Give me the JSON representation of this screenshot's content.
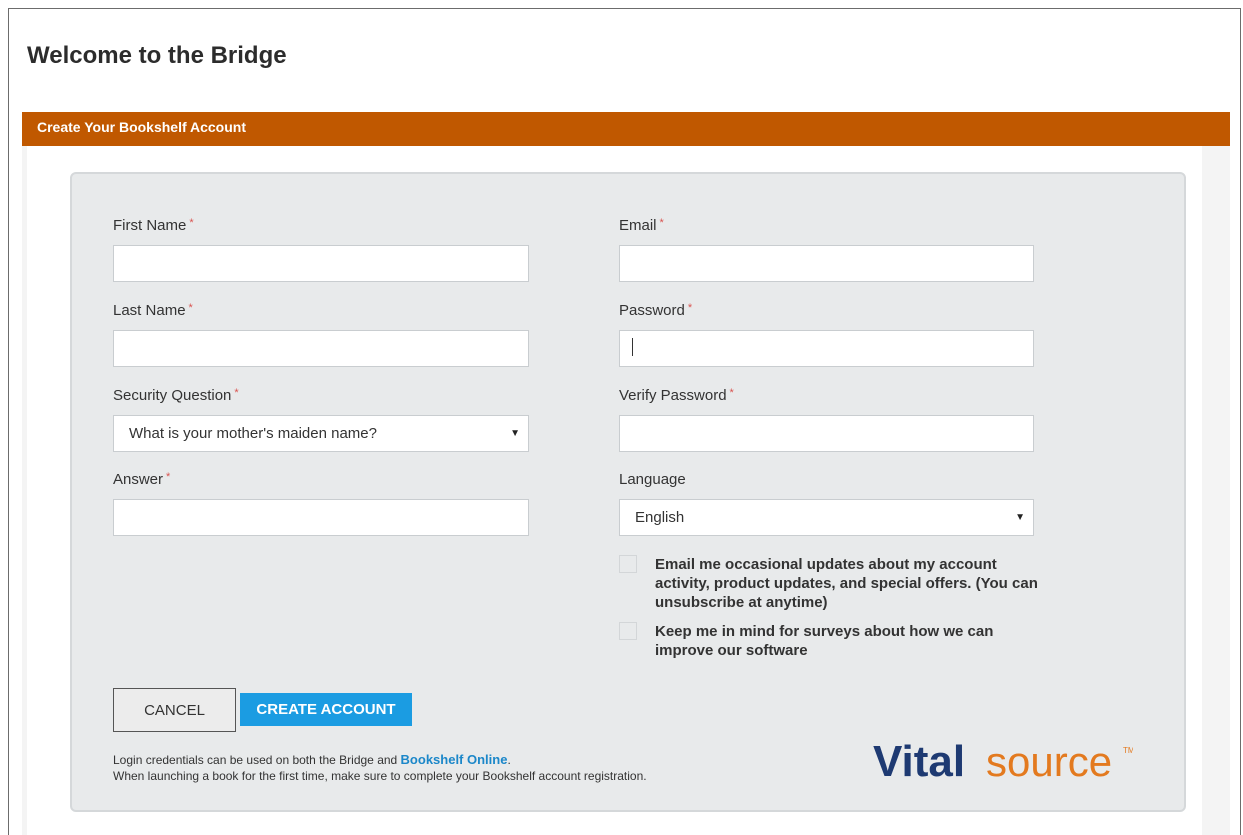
{
  "page": {
    "title": "Welcome to the Bridge"
  },
  "section": {
    "title": "Create Your Bookshelf Account"
  },
  "form": {
    "first_name": {
      "label": "First Name",
      "required": "*",
      "value": ""
    },
    "last_name": {
      "label": "Last Name",
      "required": "*",
      "value": ""
    },
    "security_question": {
      "label": "Security Question",
      "required": "*",
      "selected": "What is your mother's maiden name?"
    },
    "answer": {
      "label": "Answer",
      "required": "*",
      "value": ""
    },
    "email": {
      "label": "Email",
      "required": "*",
      "value": ""
    },
    "password": {
      "label": "Password",
      "required": "*",
      "value": ""
    },
    "verify_password": {
      "label": "Verify Password",
      "required": "*",
      "value": ""
    },
    "language": {
      "label": "Language",
      "selected": "English"
    },
    "opt_updates": {
      "label": "Email me occasional updates about my account activity, product updates, and special offers. (You can unsubscribe at anytime)",
      "checked": false
    },
    "opt_surveys": {
      "label": "Keep me in mind for surveys about how we can improve our software",
      "checked": false
    }
  },
  "buttons": {
    "cancel": "CANCEL",
    "create": "CREATE ACCOUNT"
  },
  "footer": {
    "line1_prefix": "Login credentials can be used on both the Bridge and ",
    "line1_link": "Bookshelf Online",
    "line1_suffix": ".",
    "line2": "When launching a book for the first time, make sure to complete your Bookshelf account registration."
  },
  "logo": {
    "text_bold": "Vital",
    "text_light": "source",
    "tm": "TM"
  },
  "colors": {
    "header": "#c05800",
    "primary_button": "#1b9ce2",
    "link": "#1b87c9",
    "logo_blue": "#1e3a72",
    "logo_orange": "#e37a1f"
  },
  "icons": {
    "select_arrow": "triangle-down-icon"
  }
}
